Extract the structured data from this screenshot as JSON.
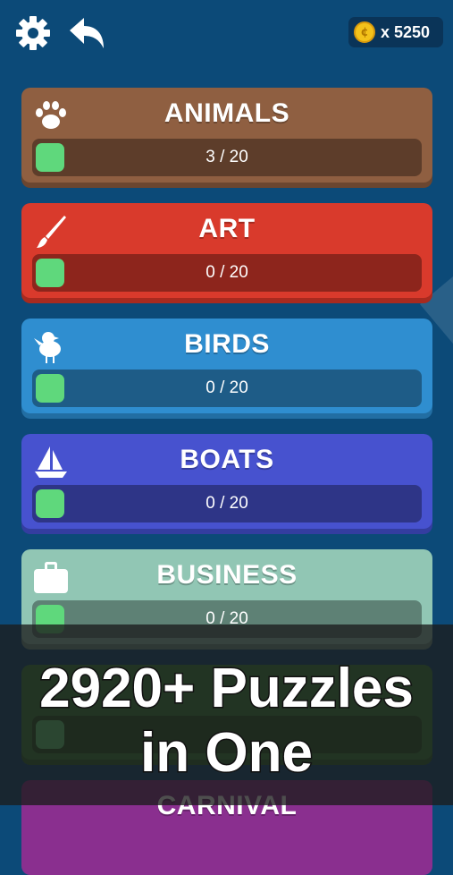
{
  "header": {
    "coin_amount": "x 5250"
  },
  "categories": [
    {
      "name": "ANIMALS",
      "progress": "3 / 20",
      "color": "#8f5f41",
      "icon": "paw-icon"
    },
    {
      "name": "ART",
      "progress": "0 / 20",
      "color": "#d93a2c",
      "icon": "paintbrush-icon"
    },
    {
      "name": "BIRDS",
      "progress": "0 / 20",
      "color": "#2f8ed0",
      "icon": "bird-icon"
    },
    {
      "name": "BOATS",
      "progress": "0 / 20",
      "color": "#4752cf",
      "icon": "sailboat-icon"
    },
    {
      "name": "BUSINESS",
      "progress": "0 / 20",
      "color": "#91c6b4",
      "icon": "briefcase-icon"
    },
    {
      "name": "",
      "progress": "",
      "color": "#3a8a3e",
      "icon": ""
    },
    {
      "name": "CARNIVAL",
      "progress": "",
      "color": "#8a2f8f",
      "icon": ""
    }
  ],
  "promo": {
    "line1": "2920+ Puzzles",
    "line2": "in One"
  }
}
